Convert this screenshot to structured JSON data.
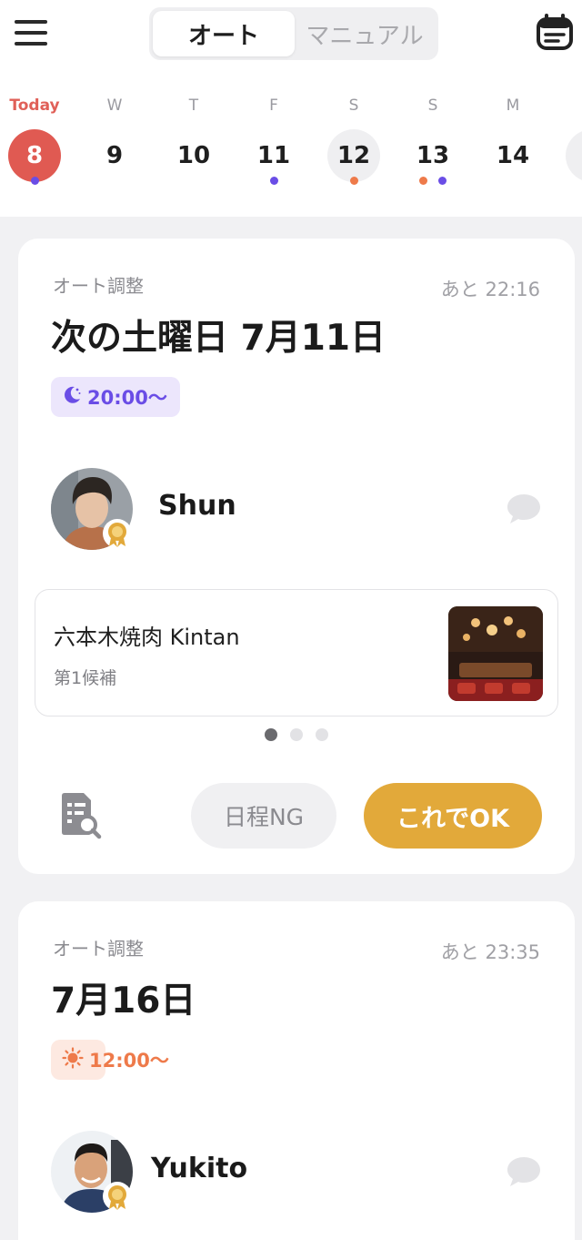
{
  "header": {
    "menu_icon": "hamburger-menu-icon",
    "segments": [
      "オート",
      "マニュアル"
    ],
    "selected_segment": "オート",
    "calendar_icon": "calendar-list-icon"
  },
  "colors": {
    "today": "#e05a52",
    "dot_purple": "#6a4de6",
    "dot_orange": "#ee7a4a",
    "accent_ok": "#e2a93a"
  },
  "week": [
    {
      "label": "Today",
      "day": "8",
      "dots": [
        "purple"
      ]
    },
    {
      "label": "W",
      "day": "9",
      "dots": []
    },
    {
      "label": "T",
      "day": "10",
      "dots": []
    },
    {
      "label": "F",
      "day": "11",
      "dots": [
        "purple"
      ]
    },
    {
      "label": "S",
      "day": "12",
      "dots": [
        "orange"
      ]
    },
    {
      "label": "S",
      "day": "13",
      "dots": [
        "orange",
        "purple"
      ]
    },
    {
      "label": "M",
      "day": "14",
      "dots": []
    }
  ],
  "cards": [
    {
      "type_label": "オート調整",
      "remaining": "あと 22:16",
      "date": "次の土曜日 7月11日",
      "time": "20:00〜",
      "time_icon": "moon-icon",
      "person": {
        "name": "Shun",
        "badge_icon": "medal-icon"
      },
      "venue": {
        "name": "六本木焼肉 Kintan",
        "candidate": "第1候補"
      },
      "pager": {
        "count": 3,
        "active": 1
      },
      "actions": {
        "search_icon": "document-search-icon",
        "ng": "日程NG",
        "ok": "これでOK"
      }
    },
    {
      "type_label": "オート調整",
      "remaining": "あと 23:35",
      "date": "7月16日",
      "time": "12:00〜",
      "time_icon": "sun-icon",
      "person": {
        "name": "Yukito",
        "badge_icon": "medal-icon"
      }
    }
  ]
}
